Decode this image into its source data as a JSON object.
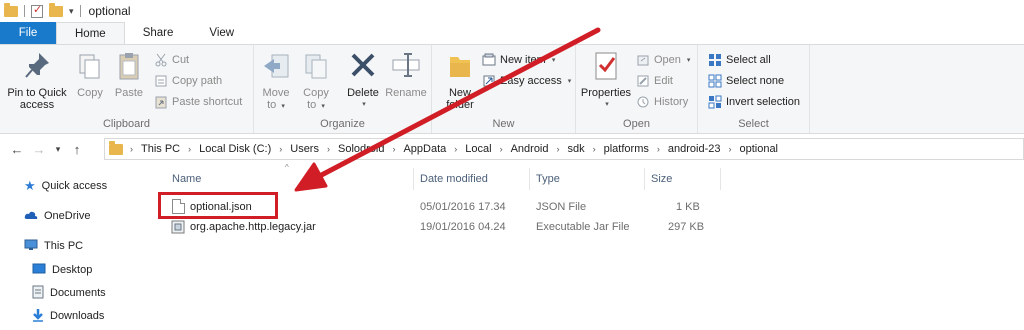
{
  "window": {
    "title": "optional"
  },
  "tabs": [
    {
      "label": "File"
    },
    {
      "label": "Home"
    },
    {
      "label": "Share"
    },
    {
      "label": "View"
    }
  ],
  "ribbon": {
    "clipboard": {
      "label": "Clipboard",
      "pin_line1": "Pin to Quick",
      "pin_line2": "access",
      "copy": "Copy",
      "paste": "Paste",
      "cut": "Cut",
      "copy_path": "Copy path",
      "paste_shortcut": "Paste shortcut"
    },
    "organize": {
      "label": "Organize",
      "move_to_line1": "Move",
      "move_to_line2": "to",
      "copy_to_line1": "Copy",
      "copy_to_line2": "to",
      "delete": "Delete",
      "rename": "Rename"
    },
    "new": {
      "label": "New",
      "new_folder_line1": "New",
      "new_folder_line2": "folder",
      "new_item": "New item",
      "easy_access": "Easy access"
    },
    "open": {
      "label": "Open",
      "properties": "Properties",
      "open": "Open",
      "edit": "Edit",
      "history": "History"
    },
    "select": {
      "label": "Select",
      "select_all": "Select all",
      "select_none": "Select none",
      "invert_selection": "Invert selection"
    }
  },
  "address": {
    "crumbs": [
      "This PC",
      "Local Disk (C:)",
      "Users",
      "Solodroid",
      "AppData",
      "Local",
      "Android",
      "sdk",
      "platforms",
      "android-23",
      "optional"
    ]
  },
  "navpane": {
    "quick_access": "Quick access",
    "onedrive": "OneDrive",
    "this_pc": "This PC",
    "desktop": "Desktop",
    "documents": "Documents",
    "downloads": "Downloads"
  },
  "columns": {
    "name": "Name",
    "date": "Date modified",
    "type": "Type",
    "size": "Size"
  },
  "files": [
    {
      "name": "optional.json",
      "date": "05/01/2016 17.34",
      "type": "JSON File",
      "size": "1 KB"
    },
    {
      "name": "org.apache.http.legacy.jar",
      "date": "19/01/2016 04.24",
      "type": "Executable Jar File",
      "size": "297 KB"
    }
  ],
  "colors": {
    "file_tab": "#1979ca",
    "annotation": "#d11e26"
  }
}
